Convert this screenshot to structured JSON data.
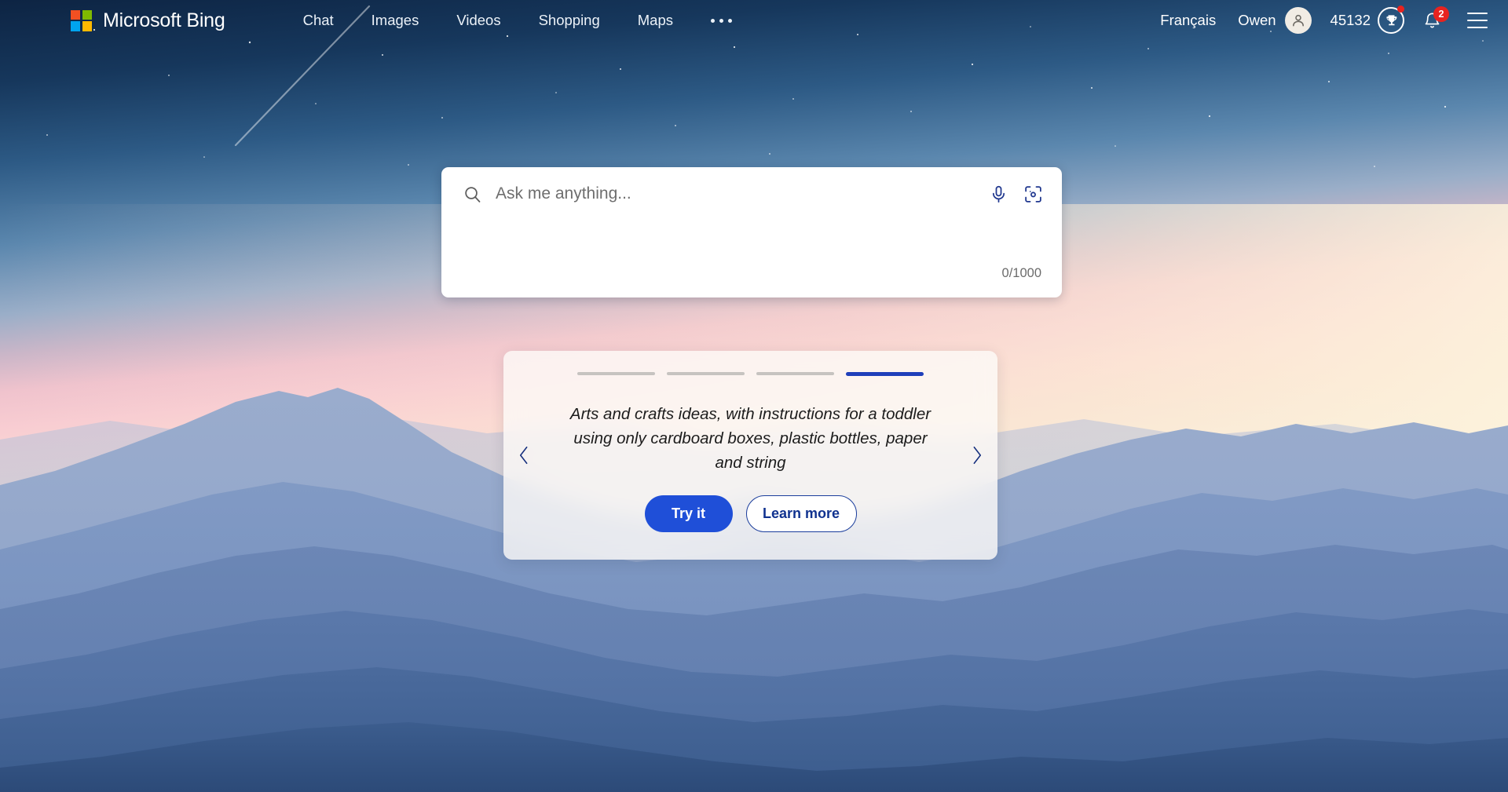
{
  "header": {
    "brand": "Microsoft Bing",
    "logo_colors": [
      "#f25022",
      "#7fba00",
      "#00a4ef",
      "#ffb900"
    ],
    "nav": [
      {
        "label": "Chat",
        "name": "nav-chat"
      },
      {
        "label": "Images",
        "name": "nav-images"
      },
      {
        "label": "Videos",
        "name": "nav-videos"
      },
      {
        "label": "Shopping",
        "name": "nav-shopping"
      },
      {
        "label": "Maps",
        "name": "nav-maps"
      }
    ],
    "more_label": "More",
    "language": "Français",
    "user_name": "Owen",
    "rewards_points": "45132",
    "notification_count": "2",
    "menu_label": "Menu"
  },
  "search": {
    "placeholder": "Ask me anything...",
    "value": "",
    "counter": "0/1000",
    "search_icon": "search-icon",
    "mic_icon": "microphone-icon",
    "visual_icon": "visual-search-icon"
  },
  "carousel": {
    "slide_text": "Arts and crafts ideas, with instructions for a toddler using only cardboard boxes, plastic bottles, paper and string",
    "total_slides": 4,
    "active_slide": 4,
    "prev_label": "Previous",
    "next_label": "Next",
    "primary_button": "Try it",
    "secondary_button": "Learn more"
  },
  "theme": {
    "accent_blue": "#1f4fd8",
    "active_bar": "#1f3fba",
    "badge_red": "#e8231f",
    "outline_blue": "#1a3d9c"
  }
}
